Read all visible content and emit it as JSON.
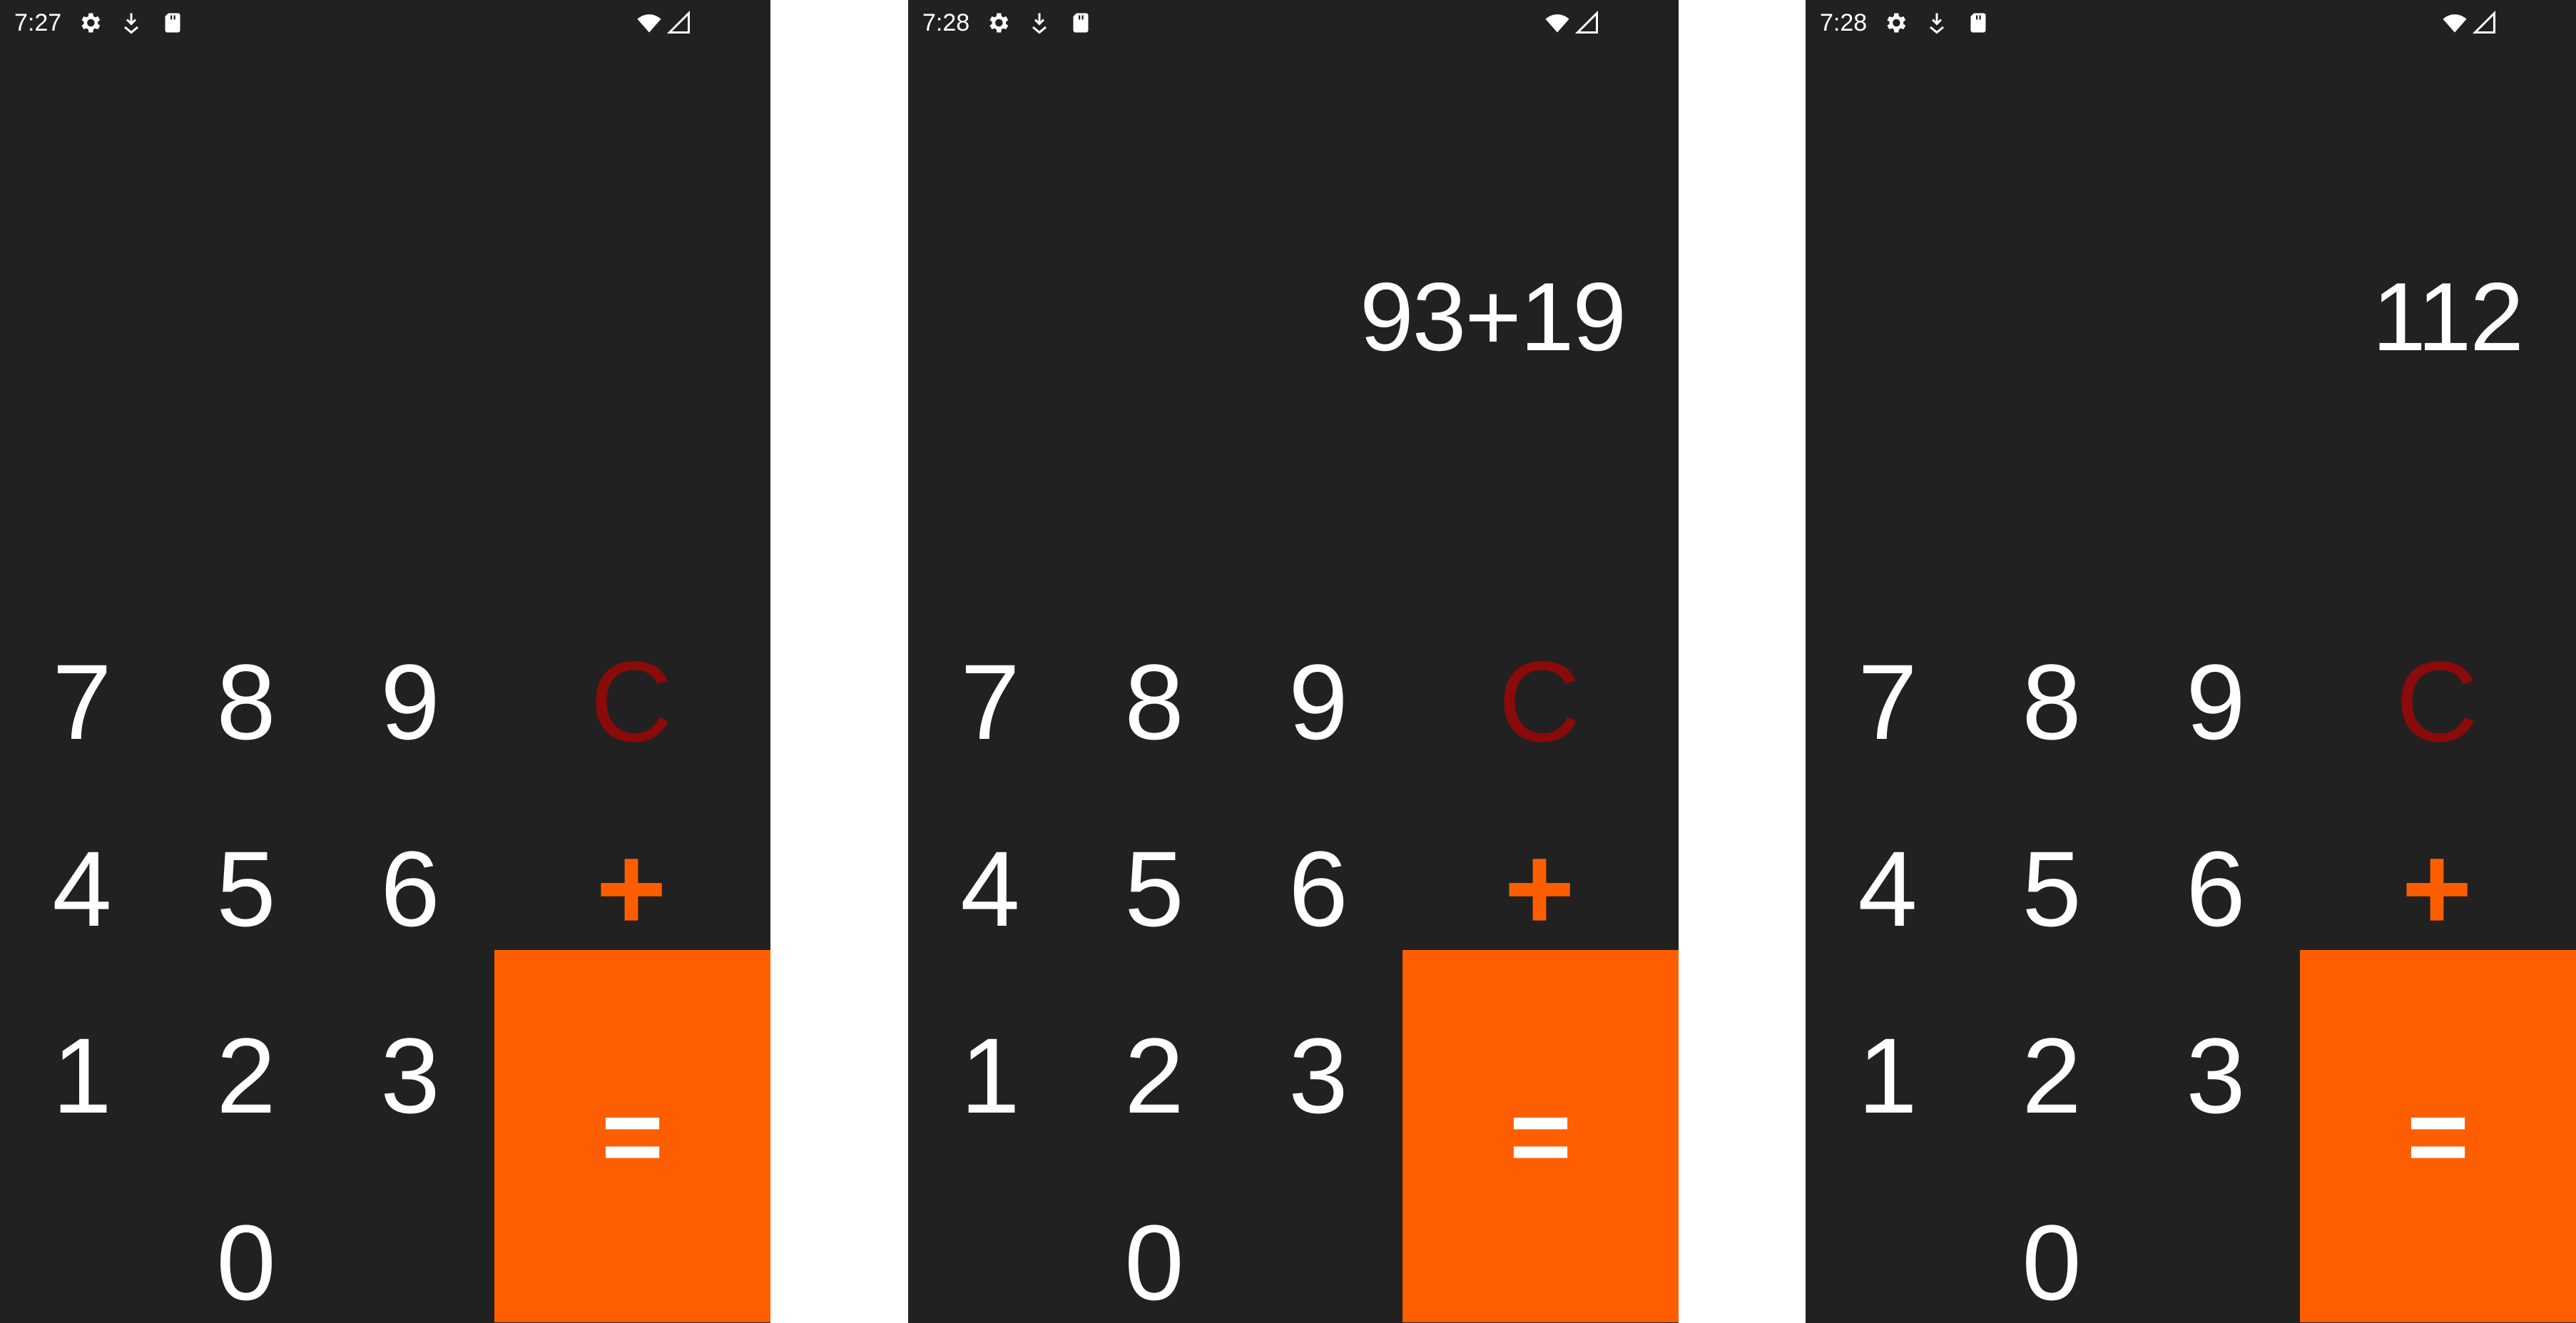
{
  "screens": [
    {
      "status": {
        "time": "7:27"
      },
      "display": ""
    },
    {
      "status": {
        "time": "7:28"
      },
      "display": "93+19"
    },
    {
      "status": {
        "time": "7:28"
      },
      "display": "112"
    }
  ],
  "status_icons": {
    "left": [
      "gear-icon",
      "download-icon",
      "sd-card-icon"
    ],
    "right": [
      "wifi-icon",
      "cell-signal-icon"
    ]
  },
  "keys": {
    "seven": "7",
    "eight": "8",
    "nine": "9",
    "four": "4",
    "five": "5",
    "six": "6",
    "one": "1",
    "two": "2",
    "three": "3",
    "zero": "0",
    "clear": "C",
    "plus": "+",
    "equals": "="
  },
  "colors": {
    "background": "#212121",
    "accent": "#ff5e00",
    "clear": "#8b0a0a",
    "text": "#ffffff"
  }
}
